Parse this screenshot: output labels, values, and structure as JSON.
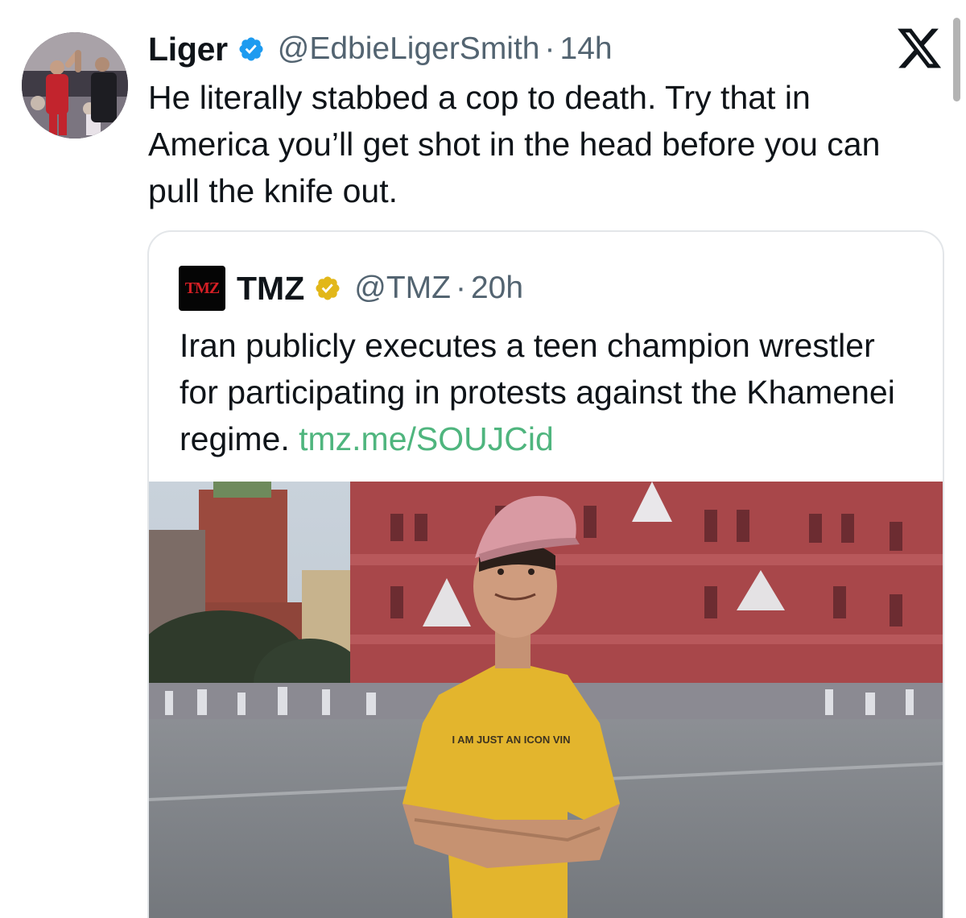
{
  "tweet": {
    "display_name": "Liger",
    "handle": "@EdbieLigerSmith",
    "separator": "·",
    "time": "14h",
    "text": "He literally stabbed a cop to death. Try that in America you’ll get shot in the head before you can pull the knife out.",
    "verified_icon": "verified-badge-blue"
  },
  "app_logo": "x-logo",
  "quoted_tweet": {
    "avatar_text": "TMZ",
    "display_name": "TMZ",
    "handle": "@TMZ",
    "separator": "·",
    "time": "20h",
    "text": "Iran publicly executes a teen champion wrestler for participating in protests against the Khamenei regime. ",
    "link": "tmz.me/SOUJCid",
    "verified_icon": "verified-badge-gold"
  },
  "media": {
    "shirt_text": "I AM JUST AN ICON VIN"
  },
  "colors": {
    "verified_blue": "#1d9bf0",
    "verified_gold": "#e2b719",
    "link_green": "#4fb57e",
    "secondary_text": "#536471"
  }
}
